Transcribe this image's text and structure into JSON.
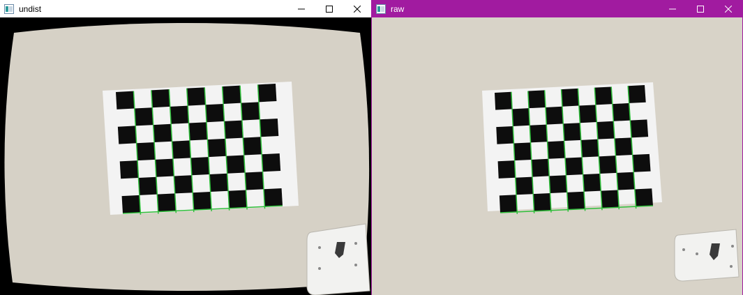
{
  "windows": [
    {
      "title": "undist",
      "titlebar_color": "#ffffff",
      "title_color": "#000000"
    },
    {
      "title": "raw",
      "titlebar_color": "#a11ba0",
      "title_color": "#ffffff"
    }
  ],
  "icons": {
    "app": "opencv-window-icon",
    "minimize": "minimize-icon",
    "maximize": "maximize-icon",
    "close": "close-icon"
  },
  "colors": {
    "wall": "#d6d1c6",
    "paper": "#f3f3f3",
    "square": "#0d0d0d",
    "corner_lines": "#2fbf3a",
    "raw_border": "#a11ba0"
  }
}
